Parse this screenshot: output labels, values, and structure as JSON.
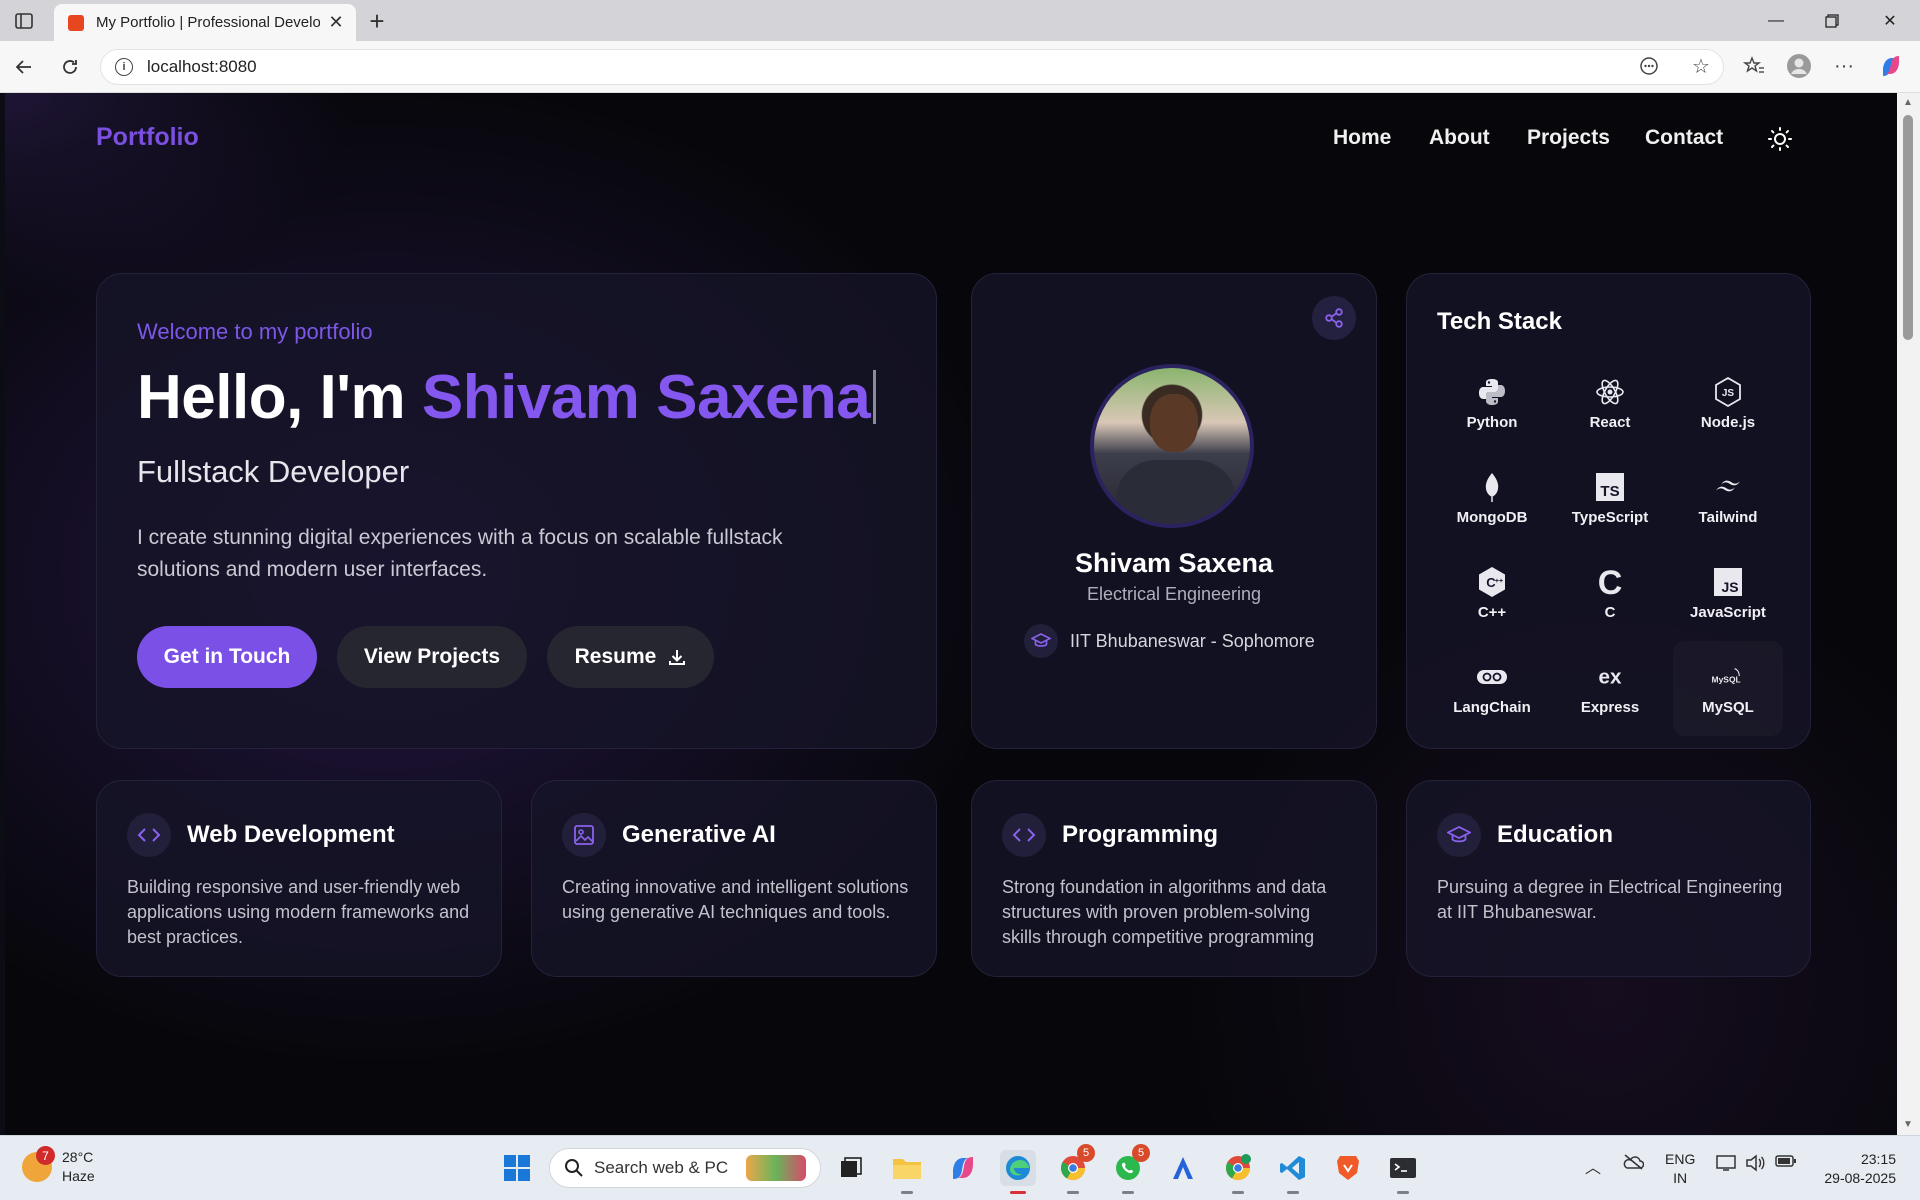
{
  "browser": {
    "tab_title": "My Portfolio | Professional Develo",
    "url": "localhost:8080"
  },
  "nav": {
    "brand": "Portfolio",
    "links": [
      "Home",
      "About",
      "Projects",
      "Contact"
    ]
  },
  "hero": {
    "welcome": "Welcome to my portfolio",
    "greeting": "Hello, I'm ",
    "name": "Shivam Saxena",
    "role": "Fullstack Developer",
    "description": "I create stunning digital experiences with a focus on scalable fullstack solutions and modern user interfaces.",
    "buttons": {
      "contact": "Get in Touch",
      "projects": "View Projects",
      "resume": "Resume"
    }
  },
  "profile": {
    "name": "Shivam Saxena",
    "department": "Electrical Engineering",
    "school": "IIT Bhubaneswar - Sophomore"
  },
  "tech_stack": {
    "title": "Tech Stack",
    "items": [
      {
        "label": "Python",
        "icon": "python-icon"
      },
      {
        "label": "React",
        "icon": "react-icon"
      },
      {
        "label": "Node.js",
        "icon": "nodejs-icon"
      },
      {
        "label": "MongoDB",
        "icon": "mongodb-icon"
      },
      {
        "label": "TypeScript",
        "icon": "typescript-icon"
      },
      {
        "label": "Tailwind",
        "icon": "tailwind-icon"
      },
      {
        "label": "C++",
        "icon": "cpp-icon"
      },
      {
        "label": "C",
        "icon": "c-icon"
      },
      {
        "label": "JavaScript",
        "icon": "javascript-icon"
      },
      {
        "label": "LangChain",
        "icon": "langchain-icon"
      },
      {
        "label": "Express",
        "icon": "express-icon"
      },
      {
        "label": "MySQL",
        "icon": "mysql-icon"
      }
    ]
  },
  "features": [
    {
      "title": "Web Development",
      "description": "Building responsive and user-friendly web applications using modern frameworks and best practices.",
      "icon": "code-icon"
    },
    {
      "title": "Generative AI",
      "description": "Creating innovative and intelligent solutions using generative AI techniques and tools.",
      "icon": "image-icon"
    },
    {
      "title": "Programming",
      "description": "Strong foundation in algorithms and data structures with proven problem-solving skills through competitive programming",
      "icon": "code-icon"
    },
    {
      "title": "Education",
      "description": "Pursuing a degree in Electrical Engineering at IIT Bhubaneswar.",
      "icon": "graduation-cap-icon"
    }
  ],
  "taskbar": {
    "weather_temp": "28°C",
    "weather_desc": "Haze",
    "weather_badge": "7",
    "search_placeholder": "Search web & PC",
    "chrome_badge": "5",
    "whatsapp_badge": "5",
    "lang_top": "ENG",
    "lang_bottom": "IN",
    "time": "23:15",
    "date": "29-08-2025"
  },
  "colors": {
    "accent": "#7b50e6",
    "background": "#07070b",
    "card": "#161428"
  }
}
